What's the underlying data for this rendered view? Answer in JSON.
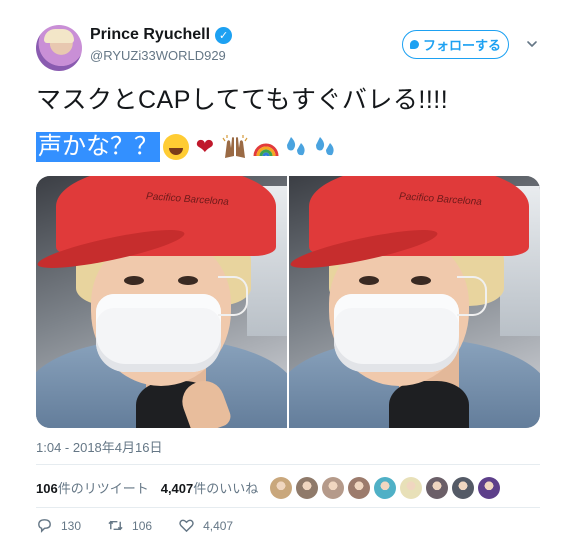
{
  "header": {
    "display_name": "Prince Ryuchell",
    "verified_glyph": "✓",
    "handle": "@RYUZi33WORLD929",
    "follow_label": "フォローする",
    "caret_icon": "chevron-down-icon"
  },
  "tweet": {
    "line1": "マスクとCAPしててもすぐバレる!!!!",
    "line2_selected": "声かな？？",
    "emojis": [
      "😂",
      "❤",
      "🙌",
      "🌈",
      "💦",
      "💦"
    ]
  },
  "media": {
    "cap_text": "Pacifico Barcelona"
  },
  "timestamp": "1:04 - 2018年4月16日",
  "stats": {
    "retweets_count": "106",
    "retweets_label": "件のリツイート",
    "likes_count": "4,407",
    "likes_label": "件のいいね"
  },
  "liker_colors": [
    "#c9a77c",
    "#8f7a6a",
    "#b59a8a",
    "#9c7b6c",
    "#4fb0c6",
    "#e8e0b8",
    "#6b5f68",
    "#545a66",
    "#5d3f8a"
  ],
  "actions": {
    "reply_count": "130",
    "retweet_count": "106",
    "like_count": "4,407"
  },
  "colors": {
    "accent": "#1da1f2",
    "selection": "#3390ff",
    "secondary_text": "#657786"
  }
}
